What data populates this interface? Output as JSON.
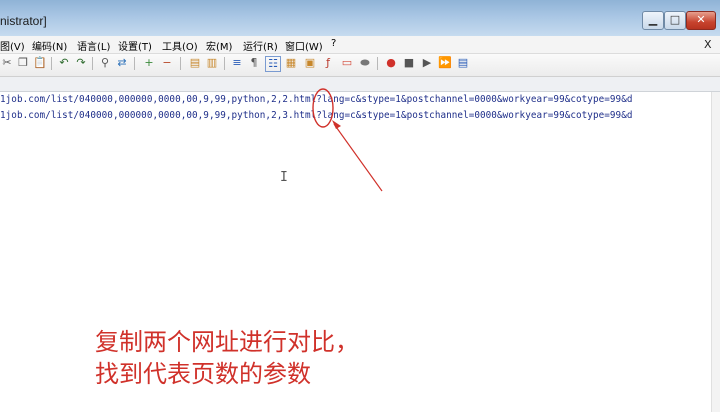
{
  "window": {
    "title": "nistrator]",
    "buttons": {
      "minimize": "▁",
      "maximize": "□",
      "close": "✕"
    }
  },
  "menu": {
    "items": [
      "图(V)",
      "编码(N)",
      "语言(L)",
      "设置(T)",
      "工具(O)",
      "宏(M)",
      "运行(R)",
      "窗口(W)",
      "?"
    ],
    "close_glyph": "X"
  },
  "toolbar": {
    "icons": [
      "cut-icon",
      "copy-icon",
      "paste-icon",
      "undo-icon",
      "redo-icon",
      "find-icon",
      "replace-icon",
      "zoom-in-icon",
      "zoom-out-icon",
      "sync-vertical-icon",
      "sync-horizontal-icon",
      "word-wrap-icon",
      "show-all-chars-icon",
      "indent-guide-icon",
      "lang-icon",
      "doc-map-icon",
      "function-list-icon",
      "folder-icon",
      "monitor-icon",
      "record-macro-icon",
      "stop-macro-icon",
      "play-macro-icon",
      "run-macro-icon",
      "save-macro-icon"
    ]
  },
  "editor": {
    "lines": [
      "1job.com/list/040000,000000,0000,00,9,99,python,2,2.html?lang=c&stype=1&postchannel=0000&workyear=99&cotype=99&d",
      "1job.com/list/040000,000000,0000,00,9,99,python,2,3.html?lang=c&stype=1&postchannel=0000&workyear=99&cotype=99&d"
    ],
    "cursor_glyph": "I"
  },
  "annotation": {
    "text": "复制两个网址进行对比，\n找到代表页数的参数",
    "color": "#d0312a"
  }
}
